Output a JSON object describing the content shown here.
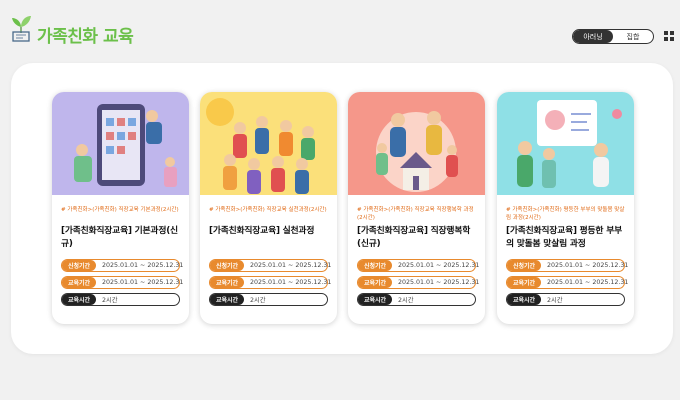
{
  "header": {
    "title": "가족친화 교육",
    "view_toggle": {
      "options": [
        "아러닝",
        "집합"
      ],
      "active": "아러닝"
    },
    "grid_icon": "grid-view-icon",
    "accent_color": "#6cc04a"
  },
  "cards": [
    {
      "category": "# 가족친화>(가족친화) 직장교육 기본과정(2시간)",
      "title": "[가족친화직장교육] 기본과정(신규)",
      "apply_label": "신청기간",
      "apply_period": "2025.01.01 ~ 2025.12.31",
      "edu_label": "교육기간",
      "edu_period": "2025.01.01 ~ 2025.12.31",
      "time_label": "교육시간",
      "time_value": "2시간",
      "thumb_bg": "#bfb6ec"
    },
    {
      "category": "# 가족친화>(가족친화) 직장교육 실천과정(2시간)",
      "title": "[가족친화직장교육] 실천과정",
      "apply_label": "신청기간",
      "apply_period": "2025.01.01 ~ 2025.12.31",
      "edu_label": "교육기간",
      "edu_period": "2025.01.01 ~ 2025.12.31",
      "time_label": "교육시간",
      "time_value": "2시간",
      "thumb_bg": "#fbe07a"
    },
    {
      "category": "# 가족친화>(가족친화) 직장교육 직장행복학 과정(2시간)",
      "title": "[가족친화직장교육] 직장행복학(신규)",
      "apply_label": "신청기간",
      "apply_period": "2025.01.01 ~ 2025.12.31",
      "edu_label": "교육기간",
      "edu_period": "2025.01.01 ~ 2025.12.31",
      "time_label": "교육시간",
      "time_value": "2시간",
      "thumb_bg": "#f5978a"
    },
    {
      "category": "# 가족친화>(가족친화) 평등한 부부의 맞돌봄 맞살림 과정(2시간)",
      "title": "[가족친화직장교육] 평등한 부부의 맞돌봄 맞살림 과정",
      "apply_label": "신청기간",
      "apply_period": "2025.01.01 ~ 2025.12.31",
      "edu_label": "교육기간",
      "edu_period": "2025.01.01 ~ 2025.12.31",
      "time_label": "교육시간",
      "time_value": "2시간",
      "thumb_bg": "#8fe0e6"
    }
  ]
}
